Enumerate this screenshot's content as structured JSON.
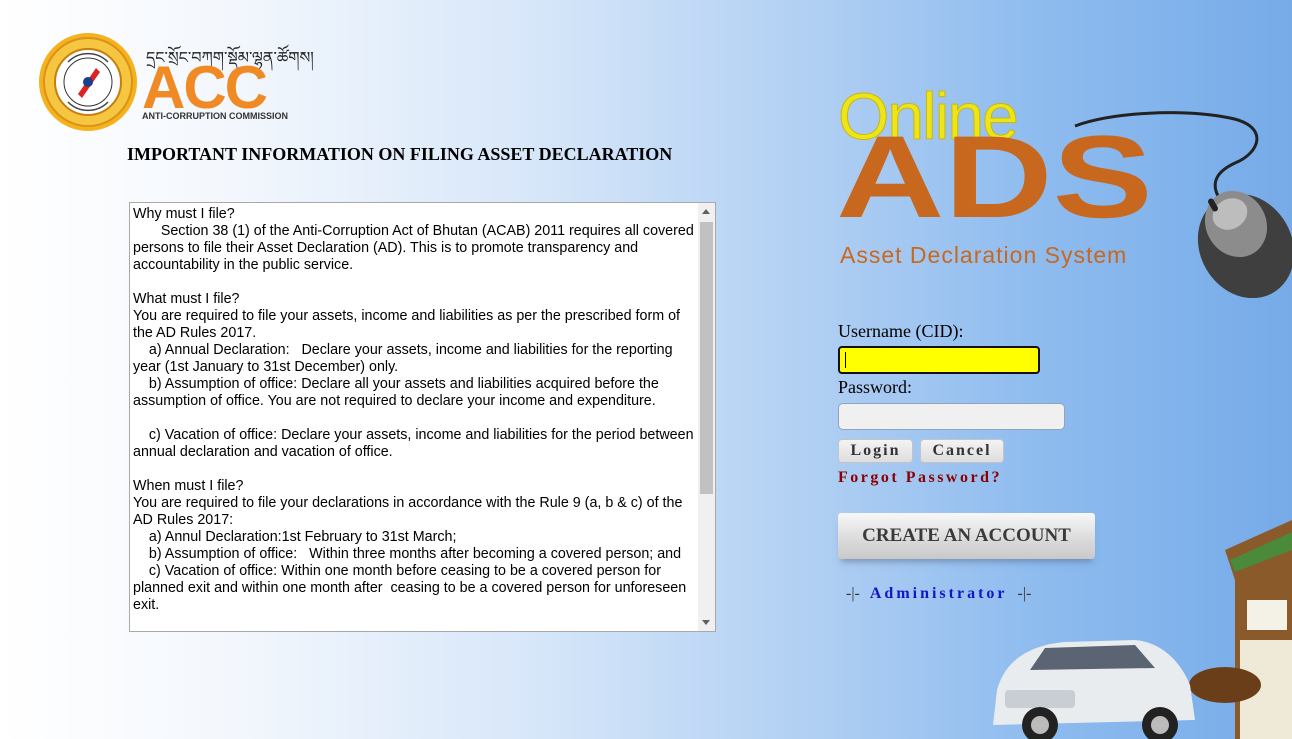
{
  "header": {
    "org_tibetan": "དྲང་སྲོང་བཀག་སྡོམ་ལྷན་ཚོགས།",
    "org_short": "ACC",
    "org_full": "ANTI-CORRUPTION COMMISSION"
  },
  "info": {
    "title": "IMPORTANT INFORMATION ON FILING ASSET DECLARATION",
    "text": "Why must I file?\n       Section 38 (1) of the Anti-Corruption Act of Bhutan (ACAB) 2011 requires all covered persons to file their Asset Declaration (AD). This is to promote transparency and accountability in the public service.\n\nWhat must I file?\nYou are required to file your assets, income and liabilities as per the prescribed form of the AD Rules 2017.\n    a) Annual Declaration:   Declare your assets, income and liabilities for the reporting year (1st January to 31st December) only.\n    b) Assumption of office: Declare all your assets and liabilities acquired before the assumption of office. You are not required to declare your income and expenditure.\n\n    c) Vacation of office: Declare your assets, income and liabilities for the period between annual declaration and vacation of office.\n\nWhen must I file?\nYou are required to file your declarations in accordance with the Rule 9 (a, b & c) of the AD Rules 2017:\n    a) Annul Declaration:1st February to 31st March;\n    b) Assumption of office:   Within three months after becoming a covered person; and\n    c) Vacation of office: Within one month before ceasing to be a covered person for planned exit and within one month after  ceasing to be a covered person for unforeseen exit."
  },
  "brand": {
    "online": "Online",
    "ads": "ADS",
    "subtitle": "Asset Declaration System"
  },
  "login": {
    "username_label": "Username (CID):",
    "password_label": "Password:",
    "login_button": "Login",
    "cancel_button": "Cancel",
    "forgot_link": "Forgot Password?",
    "create_account": "CREATE AN ACCOUNT",
    "admin_prefix": "-|-",
    "admin_link": "Administrator",
    "admin_suffix": "-|-"
  },
  "colors": {
    "username_bg": "#ffff00",
    "forgot_color": "#8b0000",
    "admin_color": "#1414c8",
    "acc_orange": "#f08a24",
    "ads_orange": "#c8681e",
    "online_yellow": "#ede41a"
  }
}
